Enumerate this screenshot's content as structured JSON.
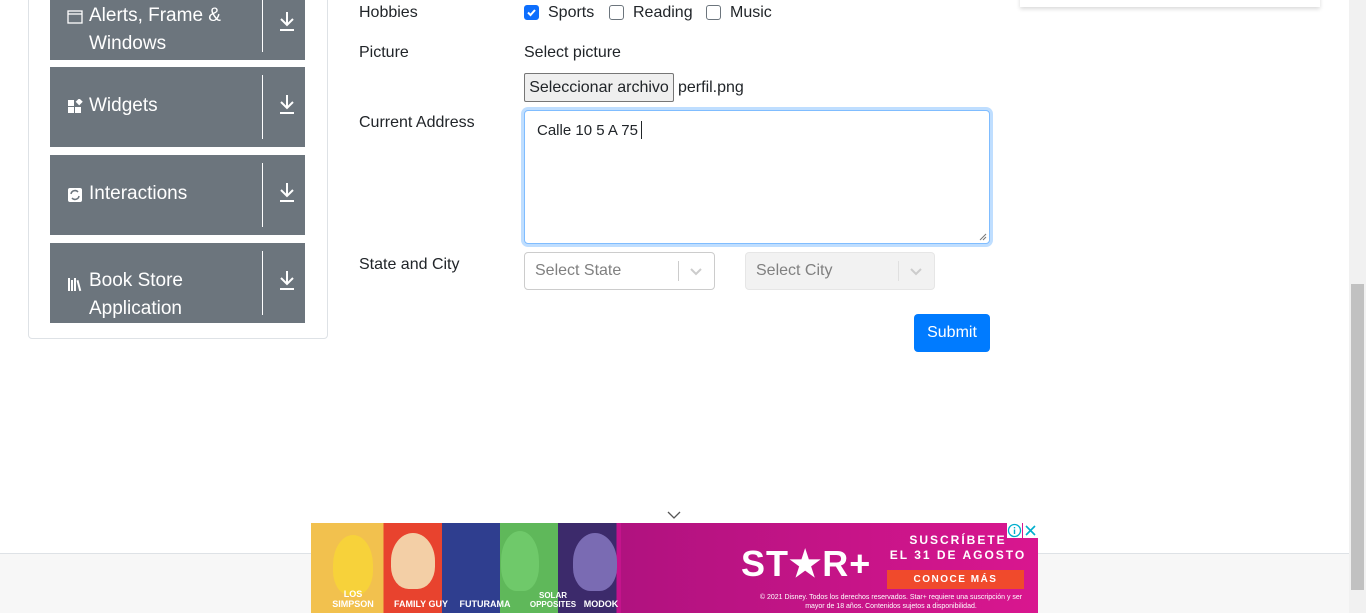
{
  "sidebar": {
    "groups": [
      {
        "label": "Alerts, Frame & Windows",
        "icon": "window-icon"
      },
      {
        "label": "Widgets",
        "icon": "widgets-icon"
      },
      {
        "label": "Interactions",
        "icon": "interactions-icon"
      },
      {
        "label": "Book Store Application",
        "icon": "books-icon"
      }
    ]
  },
  "form": {
    "hobbies_label": "Hobbies",
    "hobbies": [
      {
        "label": "Sports",
        "checked": true
      },
      {
        "label": "Reading",
        "checked": false
      },
      {
        "label": "Music",
        "checked": false
      }
    ],
    "picture_label": "Picture",
    "picture_hint": "Select picture",
    "file_button": "Seleccionar archivo",
    "file_name": "perfil.png",
    "address_label": "Current Address",
    "address_value": "Calle 10 5 A 75",
    "state_city_label": "State and City",
    "state_placeholder": "Select State",
    "city_placeholder": "Select City",
    "submit_label": "Submit"
  },
  "ad": {
    "logo": "ST★R+",
    "headline_1": "SUSCRÍBETE",
    "headline_2": "EL 31 DE AGOSTO",
    "cta": "CONOCE MÁS",
    "legal": "© 2021 Disney. Todos los derechos reservados. Star+ requiere una suscripción y ser mayor de 18 años. Contenidos sujetos a disponibilidad.",
    "shows": [
      "LOS SIMPSON",
      "FAMILY GUY",
      "FUTURAMA",
      "SOLAR OPPOSITES",
      "MODOK"
    ]
  },
  "colors": {
    "sidebar_bg": "#6c757d",
    "primary": "#007bff",
    "ad_pink": "#c4138c"
  }
}
